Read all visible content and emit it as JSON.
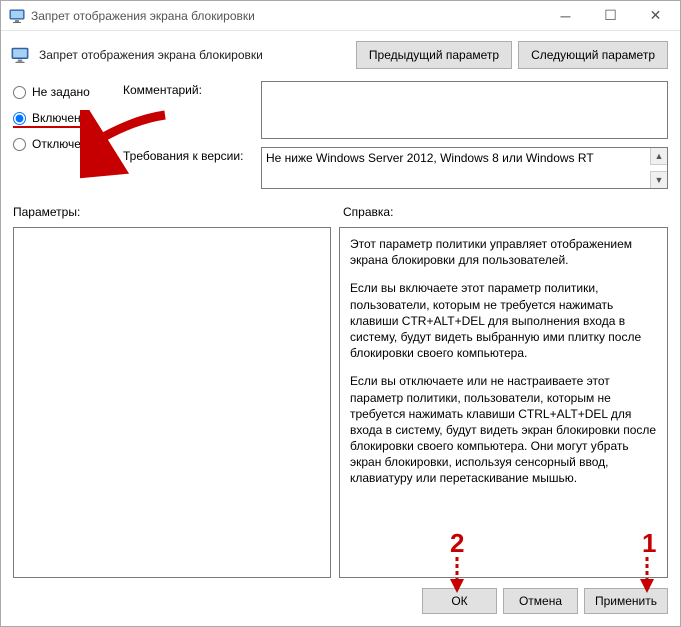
{
  "titlebar": {
    "title": "Запрет отображения экрана блокировки"
  },
  "header": {
    "title": "Запрет отображения экрана блокировки",
    "prev_btn": "Предыдущий параметр",
    "next_btn": "Следующий параметр"
  },
  "radios": {
    "not_configured": "Не задано",
    "enabled": "Включено",
    "disabled": "Отключено"
  },
  "fields": {
    "comment_label": "Комментарий:",
    "comment_value": "",
    "requirements_label": "Требования к версии:",
    "requirements_value": "Не ниже Windows Server 2012, Windows 8 или Windows RT"
  },
  "panels": {
    "params_label": "Параметры:",
    "help_label": "Справка:",
    "help_p1": "Этот параметр политики управляет отображением экрана блокировки для пользователей.",
    "help_p2": "Если вы включаете этот параметр политики, пользователи, которым не требуется нажимать клавиши CTR+ALT+DEL для выполнения входа в систему, будут видеть выбранную ими плитку после блокировки своего компьютера.",
    "help_p3": "Если вы отключаете или не настраиваете этот параметр политики, пользователи, которым не требуется нажимать клавиши CTRL+ALT+DEL для входа в систему, будут видеть экран блокировки после блокировки своего компьютера. Они могут убрать экран блокировки, используя сенсорный ввод, клавиатуру или перетаскивание мышью."
  },
  "footer": {
    "ok": "ОК",
    "cancel": "Отмена",
    "apply": "Применить"
  },
  "annotations": {
    "one": "1",
    "two": "2"
  }
}
